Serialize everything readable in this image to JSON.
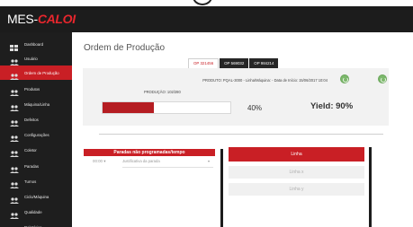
{
  "app": {
    "brand_prefix": "MES-",
    "brand_accent": "CALOI"
  },
  "colors": {
    "header_bg": "#1c1c1c",
    "sidebar_bg": "#1e1e1e",
    "accent": "#c91f25",
    "success": "#7cb86c"
  },
  "sidebar": {
    "items": [
      {
        "label": "Dashboard",
        "icon": "dashboard-icon",
        "active": false
      },
      {
        "label": "Usuário",
        "icon": "users-icon",
        "active": false
      },
      {
        "label": "Ordem de Produção",
        "icon": "users-icon",
        "active": true
      },
      {
        "label": "Produtos",
        "icon": "users-icon",
        "active": false
      },
      {
        "label": "Máquina/Linha",
        "icon": "users-icon",
        "active": false
      },
      {
        "label": "Defeitos",
        "icon": "users-icon",
        "active": false
      },
      {
        "label": "Configurações",
        "icon": "users-icon",
        "active": false
      },
      {
        "label": "Coletor",
        "icon": "users-icon",
        "active": false
      },
      {
        "label": "Paradas",
        "icon": "users-icon",
        "active": false
      },
      {
        "label": "Turnos",
        "icon": "users-icon",
        "active": false
      },
      {
        "label": "Ciclo/Máquina",
        "icon": "users-icon",
        "active": false
      },
      {
        "label": "Qualidade",
        "icon": "users-icon",
        "active": false
      },
      {
        "label": "Relatórios",
        "icon": "users-icon",
        "active": false
      }
    ]
  },
  "main": {
    "title": "Ordem de Produção",
    "tabs": [
      {
        "label": "OP 321456",
        "active": true
      },
      {
        "label": "OP 569032",
        "active": false
      },
      {
        "label": "OP 984214",
        "active": false
      }
    ],
    "order": {
      "info": "PRODUTO: PQAL-3000 - Linha/Máquina: - Data de Início: 15/06/2017 10:04",
      "production": "PRODUÇÃO: 102/280",
      "progress_percent": 40,
      "progress_label": "40%",
      "yield_label": "Yield: 90%"
    },
    "stops": {
      "title": "Paradas não programadas/tempo",
      "time_value": "00:00",
      "reason_placeholder": "Justificativa da parada"
    },
    "lines": [
      {
        "label": "Linha",
        "active": true
      },
      {
        "label": "Linha x",
        "active": false
      },
      {
        "label": "Linha y",
        "active": false
      }
    ]
  }
}
